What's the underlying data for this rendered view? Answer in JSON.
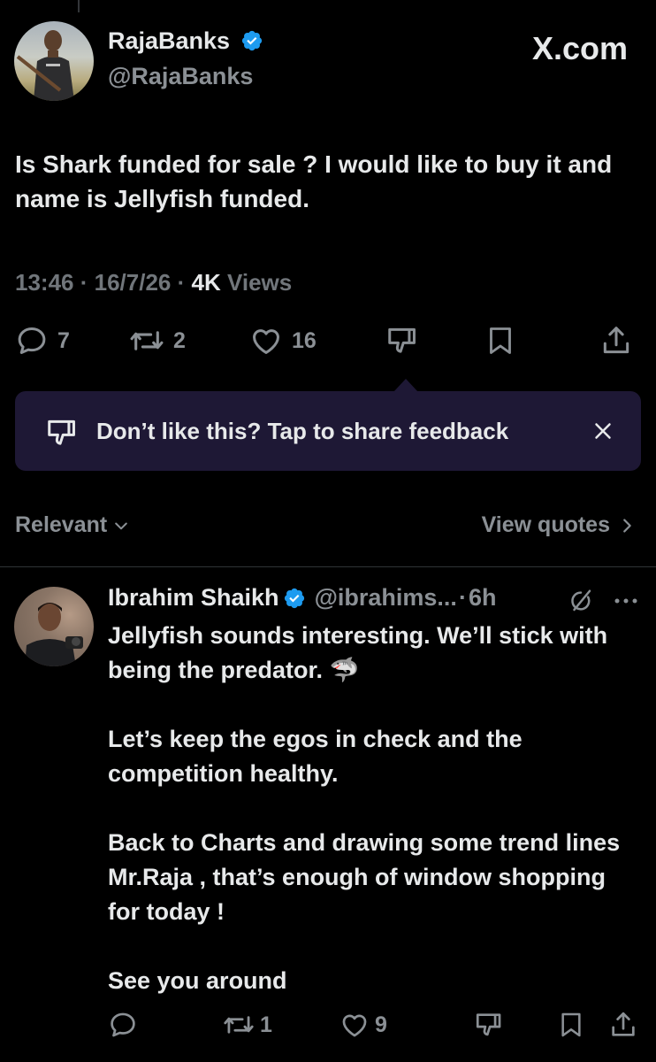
{
  "site": {
    "brand": "X.com"
  },
  "tweet": {
    "author_name": "RajaBanks",
    "author_handle": "@RajaBanks",
    "verified": true,
    "text": "Is Shark funded for sale ?  I would like to buy it and name is Jellyfish funded.",
    "time": "13:46",
    "date": "16/7/26",
    "views_count": "4K",
    "views_label": "Views",
    "actions": {
      "replies": "7",
      "reposts": "2",
      "likes": "16"
    }
  },
  "feedback_prompt": {
    "text": "Don’t like this? Tap to share feedback"
  },
  "sort": {
    "label": "Relevant",
    "view_quotes": "View quotes"
  },
  "reply": {
    "author_name": "Ibrahim Shaikh",
    "author_handle": "@ibrahims...",
    "time": "6h",
    "verified": true,
    "paragraphs": [
      "Jellyfish sounds interesting. We’ll stick with being the predator. 🦈",
      "Let’s keep the egos in check and the competition healthy.",
      "Back to Charts and drawing some trend lines Mr.Raja , that’s enough of window shopping for today !",
      "See you around"
    ],
    "actions": {
      "reposts": "1",
      "likes": "9"
    }
  },
  "colors": {
    "background": "#000000",
    "text": "#e7e9ea",
    "secondary": "#71767b",
    "verified": "#1d9bf0",
    "feedback_bg": "#1e1835"
  }
}
